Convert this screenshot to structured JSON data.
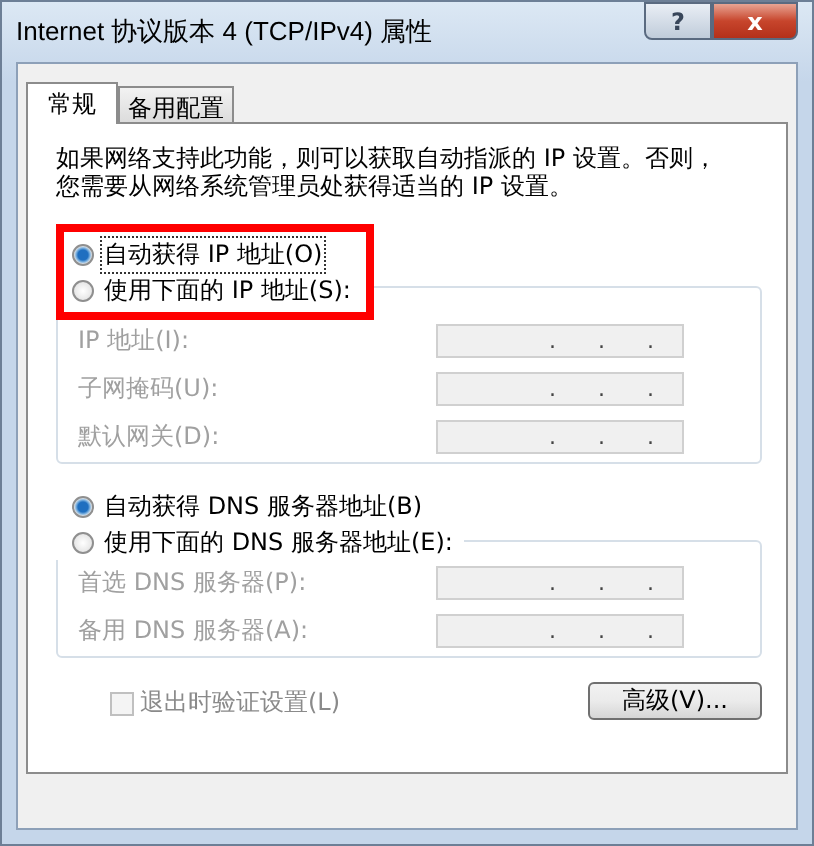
{
  "window": {
    "title": "Internet 协议版本 4 (TCP/IPv4) 属性",
    "help_button": "?",
    "close_button": "x"
  },
  "tabs": [
    {
      "label": "常规",
      "selected": true
    },
    {
      "label": "备用配置",
      "selected": false
    }
  ],
  "description": "如果网络支持此功能，则可以获取自动指派的 IP 设置。否则，您需要从网络系统管理员处获得适当的 IP 设置。",
  "ip_options": {
    "highlighted": true,
    "items": [
      {
        "label": "自动获得 IP 地址(O)",
        "selected": true,
        "focused": true
      },
      {
        "label": "使用下面的 IP 地址(S):",
        "selected": false,
        "focused": false
      }
    ]
  },
  "ip_fields": [
    {
      "label": "IP 地址(I):",
      "value": ".      .      .",
      "disabled": true
    },
    {
      "label": "子网掩码(U):",
      "value": ".      .      .",
      "disabled": true
    },
    {
      "label": "默认网关(D):",
      "value": ".      .      .",
      "disabled": true
    }
  ],
  "dns_options": [
    {
      "label": "自动获得 DNS 服务器地址(B)",
      "selected": true
    },
    {
      "label": "使用下面的 DNS 服务器地址(E):",
      "selected": false
    }
  ],
  "dns_fields": [
    {
      "label": "首选 DNS 服务器(P):",
      "value": ".      .      .",
      "disabled": true
    },
    {
      "label": "备用 DNS 服务器(A):",
      "value": ".      .      .",
      "disabled": true
    }
  ],
  "validate_checkbox": {
    "label": "退出时验证设置(L)",
    "checked": false,
    "disabled": true
  },
  "advanced_button": "高级(V)..."
}
